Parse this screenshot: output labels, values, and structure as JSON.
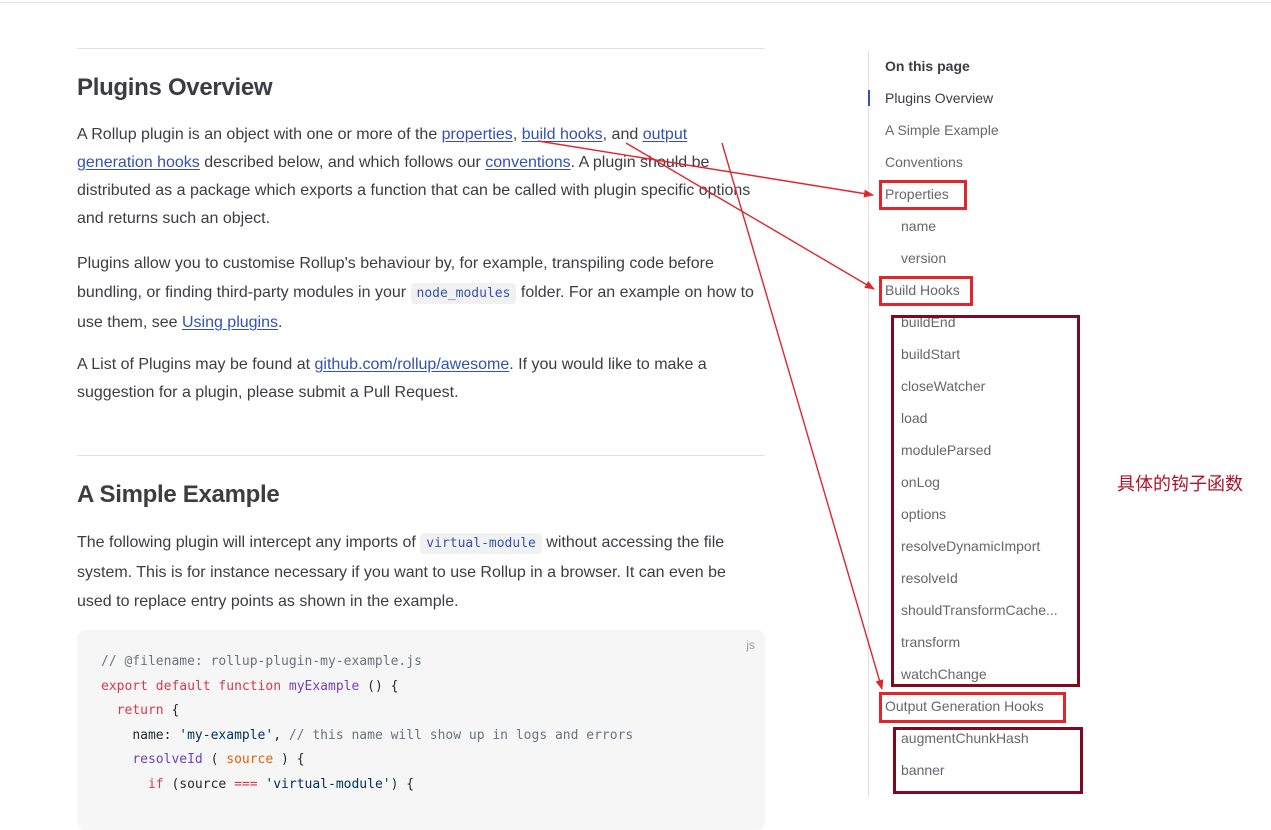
{
  "article": {
    "section1": {
      "heading": "Plugins Overview",
      "p1": {
        "t1": "A Rollup plugin is an object with one or more of the ",
        "link_properties": "properties",
        "t2": ", ",
        "link_build_hooks": "build hooks",
        "t3": ", and ",
        "link_output_hooks": "output generation hooks",
        "t4": " described below, and which follows our ",
        "link_conventions": "conventions",
        "t5": ". A plugin should be distributed as a package which exports a function that can be called with plugin specific options and returns such an object."
      },
      "p2": {
        "t1": "Plugins allow you to customise Rollup's behaviour by, for example, transpiling code before bundling, or finding third-party modules in your ",
        "code": "node_modules",
        "t2": " folder. For an example on how to use them, see ",
        "link_using_plugins": "Using plugins",
        "t3": "."
      },
      "p3": {
        "t1": "A List of Plugins may be found at ",
        "link_awesome": "github.com/rollup/awesome",
        "t2": ". If you would like to make a suggestion for a plugin, please submit a Pull Request."
      }
    },
    "section2": {
      "heading": "A Simple Example",
      "p1": {
        "t1": "The following plugin will intercept any imports of ",
        "code": "virtual-module",
        "t2": " without accessing the file system. This is for instance necessary if you want to use Rollup in a browser. It can even be used to replace entry points as shown in the example."
      },
      "code_block": {
        "lang": "js",
        "line1": "// @filename: rollup-plugin-my-example.js",
        "line2_kw1": "export",
        "line2_kw2": "default",
        "line2_kw3": "function",
        "line2_fn": "myExample",
        "line2_rest": " () {",
        "line3_kw": "return",
        "line3_rest": " {",
        "line4_key": "name: ",
        "line4_str": "'my-example'",
        "line4_punct": ", ",
        "line4_com": "// this name will show up in logs and errors",
        "line5_fn": "resolveId",
        "line5_p1": " ( ",
        "line5_var": "source",
        "line5_p2": " ) {",
        "line6_kw": "if",
        "line6_p1": " (source ",
        "line6_op": "===",
        "line6_sp": " ",
        "line6_str": "'virtual-module'",
        "line6_p2": ") {"
      }
    }
  },
  "toc": {
    "title": "On this page",
    "items": [
      "Plugins Overview",
      "A Simple Example",
      "Conventions",
      "Properties",
      "name",
      "version",
      "Build Hooks",
      "buildEnd",
      "buildStart",
      "closeWatcher",
      "load",
      "moduleParsed",
      "onLog",
      "options",
      "resolveDynamicImport",
      "resolveId",
      "shouldTransformCache...",
      "transform",
      "watchChange",
      "Output Generation Hooks",
      "augmentChunkHash",
      "banner"
    ]
  },
  "annotation": {
    "note": "具体的钩子函数",
    "red_color": "#e0262d",
    "dark_color": "#7d0a1f"
  }
}
